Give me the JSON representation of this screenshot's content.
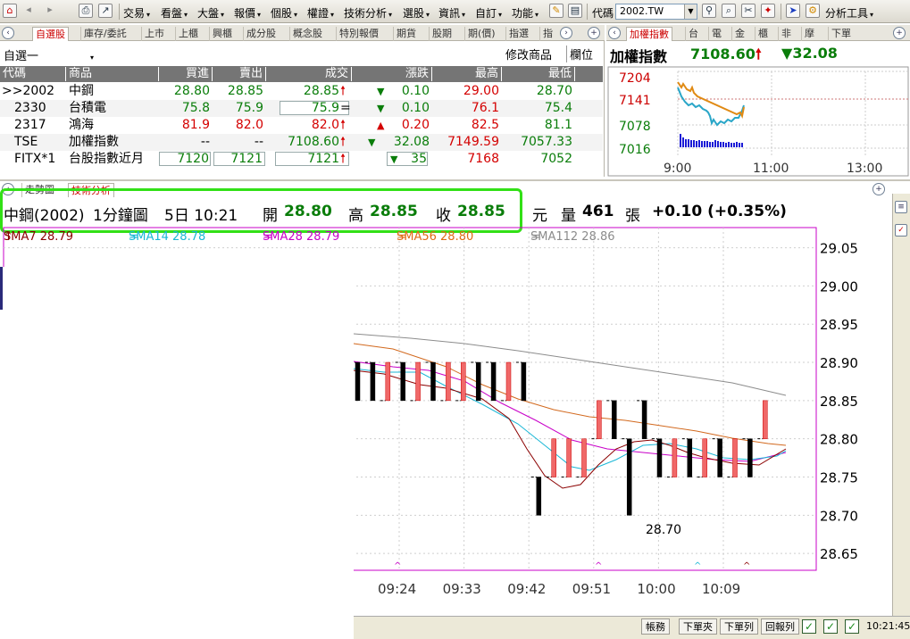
{
  "menubar": {
    "items": [
      {
        "label": "交易"
      },
      {
        "label": "看盤"
      },
      {
        "label": "大盤"
      },
      {
        "label": "報價"
      },
      {
        "label": "個股"
      },
      {
        "label": "權證"
      },
      {
        "label": "技術分析"
      },
      {
        "label": "選股"
      },
      {
        "label": "資訊"
      },
      {
        "label": "自訂"
      },
      {
        "label": "功能"
      }
    ],
    "code_label": "代碼",
    "code_value": "2002.TW",
    "analysis_tools": "分析工具"
  },
  "quote_panel": {
    "tabs": [
      "自選股",
      "庫存/委託",
      "上市",
      "上櫃",
      "興櫃",
      "成分股",
      "概念股",
      "特別報價",
      "期貨",
      "股期",
      "期(價)",
      "指選",
      "指"
    ],
    "active_tab": "自選股",
    "watchlist": "自選一",
    "edit_button": "修改商品",
    "column_button": "欄位",
    "columns": [
      "代碼",
      "商品",
      "買進",
      "賣出",
      "成交",
      "漲跌",
      "最高",
      "最低"
    ],
    "rows": [
      {
        "code": ">>2002",
        "name": "中鋼",
        "bid": "28.80",
        "ask": "28.85",
        "last": "28.85",
        "last_arrow": "🠕",
        "chg_arrow": "▼",
        "chg": "0.10",
        "high": "29.00",
        "low": "28.70",
        "color": "green"
      },
      {
        "code": "2330",
        "name": "台積電",
        "bid": "75.8",
        "ask": "75.9",
        "last": "75.9",
        "last_arrow": "=",
        "chg_arrow": "▼",
        "chg": "0.10",
        "high": "76.1",
        "low": "75.4",
        "color": "green"
      },
      {
        "code": "2317",
        "name": "鴻海",
        "bid": "81.9",
        "ask": "82.0",
        "last": "82.0",
        "last_arrow": "🠕",
        "chg_arrow": "▲",
        "chg": "0.20",
        "high": "82.5",
        "low": "81.1",
        "color": "red"
      },
      {
        "code": "TSE",
        "name": "加權指數",
        "bid": "--",
        "ask": "--",
        "last": "7108.60",
        "last_arrow": "🠕",
        "chg_arrow": "▼",
        "chg": "32.08",
        "high": "7149.59",
        "low": "7057.33",
        "color": "green"
      },
      {
        "code": "FITX*1",
        "name": "台股指數近月",
        "bid": "7120",
        "ask": "7121",
        "last": "7121",
        "last_arrow": "🠕",
        "chg_arrow": "▼",
        "chg": "35",
        "high": "7168",
        "low": "7052",
        "color": "mixed"
      }
    ]
  },
  "index_panel": {
    "tabs": [
      "加權指數",
      "台",
      "電",
      "金",
      "櫃",
      "非",
      "摩",
      "下單"
    ],
    "title": "加權指數",
    "value": "7108.60",
    "value_arrow": "🠕",
    "change_arrow": "▼",
    "change": "32.08",
    "y_ticks": [
      "7204",
      "7141",
      "7078",
      "7016"
    ],
    "x_ticks": [
      "9:00",
      "11:00",
      "13:00"
    ]
  },
  "chart_panel": {
    "tabs": [
      "走勢圖",
      "技術分析"
    ],
    "stock": "中鋼(2002)",
    "period": "1分鐘圖",
    "date": "5日 10:21",
    "open_label": "開",
    "open": "28.80",
    "high_label": "高",
    "high": "28.85",
    "close_label": "收",
    "close": "28.85",
    "unit": "元",
    "volume_label": "量",
    "volume": "461",
    "volume_unit": "張",
    "change": "+0.10 (+0.35%)",
    "sma": [
      {
        "label": "SMA7 28.79",
        "mark": "↑",
        "color": "#8b0000"
      },
      {
        "label": "SMA14 28.78",
        "mark": "=",
        "color": "#19b7d6"
      },
      {
        "label": "SMA28 28.79",
        "mark": "=",
        "color": "#c800c8"
      },
      {
        "label": "SMA56 28.80",
        "mark": "=",
        "color": "#e06a14"
      },
      {
        "label": "SMA112 28.86",
        "mark": "=",
        "color": "#8c8c8c"
      }
    ],
    "low_annotation": "28.70"
  },
  "chart_data": {
    "type": "candlestick",
    "y_ticks": [
      "29.05",
      "29.00",
      "28.95",
      "28.90",
      "28.85",
      "28.80",
      "28.75",
      "28.70",
      "28.65"
    ],
    "ylim": [
      28.635,
      29.06
    ],
    "x_ticks": [
      "09:24",
      "09:33",
      "09:42",
      "09:51",
      "10:00",
      "10:09"
    ],
    "candles": [
      {
        "open": 28.9,
        "close": 28.85,
        "high": 28.9,
        "low": 28.85
      },
      {
        "open": 28.9,
        "close": 28.85,
        "high": 28.9,
        "low": 28.85
      },
      {
        "open": 28.85,
        "close": 28.9,
        "high": 28.9,
        "low": 28.85
      },
      {
        "open": 28.9,
        "close": 28.85,
        "high": 28.9,
        "low": 28.85
      },
      {
        "open": 28.85,
        "close": 28.9,
        "high": 28.9,
        "low": 28.85
      },
      {
        "open": 28.9,
        "close": 28.85,
        "high": 28.9,
        "low": 28.85
      },
      {
        "open": 28.85,
        "close": 28.9,
        "high": 28.9,
        "low": 28.85
      },
      {
        "open": 28.85,
        "close": 28.9,
        "high": 28.9,
        "low": 28.85
      },
      {
        "open": 28.9,
        "close": 28.85,
        "high": 28.9,
        "low": 28.85
      },
      {
        "open": 28.9,
        "close": 28.85,
        "high": 28.9,
        "low": 28.85
      },
      {
        "open": 28.85,
        "close": 28.9,
        "high": 28.9,
        "low": 28.85
      },
      {
        "open": 28.9,
        "close": 28.85,
        "high": 28.9,
        "low": 28.85
      },
      {
        "open": 28.75,
        "close": 28.7,
        "high": 28.75,
        "low": 28.7
      },
      {
        "open": 28.75,
        "close": 28.8,
        "high": 28.8,
        "low": 28.75
      },
      {
        "open": 28.75,
        "close": 28.8,
        "high": 28.8,
        "low": 28.75
      },
      {
        "open": 28.75,
        "close": 28.8,
        "high": 28.8,
        "low": 28.75
      },
      {
        "open": 28.8,
        "close": 28.85,
        "high": 28.85,
        "low": 28.8
      },
      {
        "open": 28.85,
        "close": 28.8,
        "high": 28.85,
        "low": 28.8
      },
      {
        "open": 28.8,
        "close": 28.7,
        "high": 28.8,
        "low": 28.7
      },
      {
        "open": 28.85,
        "close": 28.8,
        "high": 28.85,
        "low": 28.8
      },
      {
        "open": 28.8,
        "close": 28.75,
        "high": 28.8,
        "low": 28.75
      },
      {
        "open": 28.75,
        "close": 28.8,
        "high": 28.8,
        "low": 28.75
      },
      {
        "open": 28.8,
        "close": 28.75,
        "high": 28.8,
        "low": 28.75
      },
      {
        "open": 28.75,
        "close": 28.8,
        "high": 28.8,
        "low": 28.75
      },
      {
        "open": 28.8,
        "close": 28.75,
        "high": 28.8,
        "low": 28.75
      },
      {
        "open": 28.75,
        "close": 28.8,
        "high": 28.8,
        "low": 28.75
      },
      {
        "open": 28.8,
        "close": 28.75,
        "high": 28.8,
        "low": 28.75
      },
      {
        "open": 28.8,
        "close": 28.85,
        "high": 28.85,
        "low": 28.8
      }
    ]
  }
}
